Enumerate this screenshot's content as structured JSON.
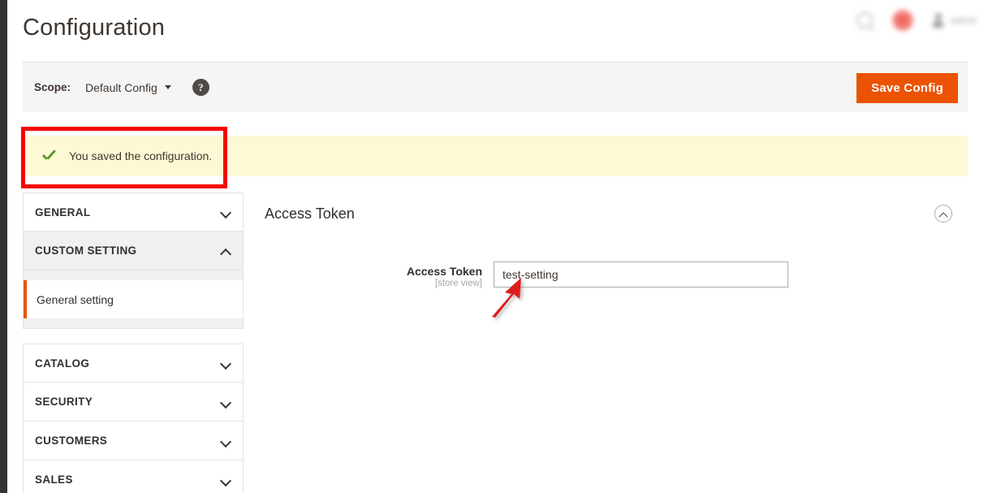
{
  "header": {
    "title": "Configuration",
    "search_icon": "search-icon",
    "notification_icon": "notification-bell-icon",
    "account_icon": "user-account-icon",
    "account_name": "admin"
  },
  "scope_bar": {
    "label": "Scope:",
    "selected_scope": "Default Config",
    "help_icon": "question-mark-icon",
    "save_label": "Save Config",
    "accent_color": "#eb5202"
  },
  "message": {
    "text": "You saved the configuration.",
    "icon": "check-mark-icon",
    "background_color": "#fdf9d5",
    "icon_color": "#5c9c2f"
  },
  "annotations": {
    "box_color": "#f60000",
    "arrow_color": "#e01b1b"
  },
  "sidebar": {
    "groups": [
      {
        "sections": [
          {
            "label": "GENERAL",
            "expanded": false,
            "chevron": "chevron-down-icon"
          },
          {
            "label": "CUSTOM SETTING",
            "expanded": true,
            "chevron": "chevron-up-icon",
            "children": [
              {
                "label": "General setting",
                "active": true
              }
            ]
          }
        ]
      },
      {
        "sections": [
          {
            "label": "CATALOG",
            "expanded": false,
            "chevron": "chevron-down-icon"
          },
          {
            "label": "SECURITY",
            "expanded": false,
            "chevron": "chevron-down-icon"
          },
          {
            "label": "CUSTOMERS",
            "expanded": false,
            "chevron": "chevron-down-icon"
          },
          {
            "label": "SALES",
            "expanded": false,
            "chevron": "chevron-down-icon"
          }
        ]
      }
    ]
  },
  "content": {
    "section_title": "Access Token",
    "collapse_icon": "chevron-up-circle-icon",
    "fields": [
      {
        "label": "Access Token",
        "scope_note": "[store view]",
        "value": "test-setting",
        "placeholder": ""
      }
    ]
  }
}
